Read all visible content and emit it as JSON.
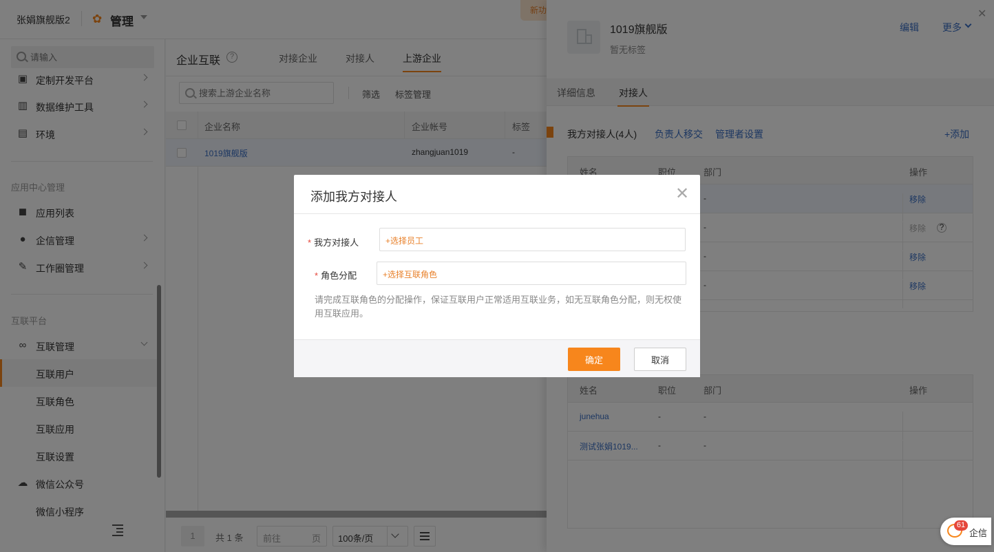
{
  "topbar": {
    "company": "张娟旗舰版2",
    "manage": "管理",
    "new_tag": "新功"
  },
  "sidebar": {
    "search_placeholder": "请输入",
    "items_top": [
      {
        "label": "定制开发平台",
        "icon": "monitor-icon"
      },
      {
        "label": "数据维护工具",
        "icon": "chart-bar-icon"
      },
      {
        "label": "环境",
        "icon": "pulse-icon"
      }
    ],
    "group_app": "应用中心管理",
    "items_app": [
      {
        "label": "应用列表",
        "icon": "grid-icon"
      },
      {
        "label": "企信管理",
        "icon": "message-icon"
      },
      {
        "label": "工作圈管理",
        "icon": "edit-icon"
      }
    ],
    "group_link": "互联平台",
    "link_manage": "互联管理",
    "sub_items": [
      "互联用户",
      "互联角色",
      "互联应用",
      "互联设置"
    ],
    "items_bottom": [
      {
        "label": "微信公众号",
        "icon": "wechat-icon"
      },
      {
        "label": "微信小程序"
      }
    ]
  },
  "main": {
    "title": "企业互联",
    "tabs": [
      "对接企业",
      "对接人",
      "上游企业"
    ],
    "search_placeholder": "搜索上游企业名称",
    "filter": "筛选",
    "tag_manage": "标签管理",
    "columns": [
      "企业名称",
      "企业帐号",
      "标签"
    ],
    "rows": [
      {
        "name": "1019旗舰版",
        "account": "zhangjuan1019",
        "tag": "-"
      }
    ],
    "pager": {
      "page": "1",
      "total": "共 1 条",
      "goto_prefix": "前往",
      "goto_suffix": "页",
      "page_size": "100条/页"
    }
  },
  "drawer": {
    "company_name": "1019旗舰版",
    "no_tag": "暂无标签",
    "edit": "编辑",
    "more": "更多",
    "tabs": [
      "详细信息",
      "对接人"
    ],
    "section_title": "我方对接人(4人)",
    "transfer": "负责人移交",
    "admin_settings": "管理者设置",
    "add": "+添加",
    "columns": [
      "姓名",
      "职位",
      "部门",
      "操作"
    ],
    "our_rows": [
      {
        "dept": "-",
        "op": "移除"
      },
      {
        "dept": "-",
        "op": "移除"
      },
      {
        "dept": "-",
        "op": "移除"
      },
      {
        "dept": "-",
        "op": "移除"
      }
    ],
    "their_rows": [
      {
        "name": "junehua",
        "pos": "-",
        "dept": "-"
      },
      {
        "name": "测试张娟1019...",
        "pos": "-",
        "dept": "-"
      }
    ]
  },
  "modal": {
    "title": "添加我方对接人",
    "field1_label": "我方对接人",
    "field1_placeholder": "+选择员工",
    "field2_label": "角色分配",
    "field2_placeholder": "+选择互联角色",
    "hint": "请完成互联角色的分配操作，保证互联用户正常适用互联业务，如无互联角色分配，则无权使用互联应用。",
    "ok": "确定",
    "cancel": "取消"
  },
  "chat": {
    "badge": "61",
    "label": "企信"
  },
  "colors": {
    "accent": "#f7861c",
    "link": "#3a6fc4",
    "required": "#e5473c"
  }
}
